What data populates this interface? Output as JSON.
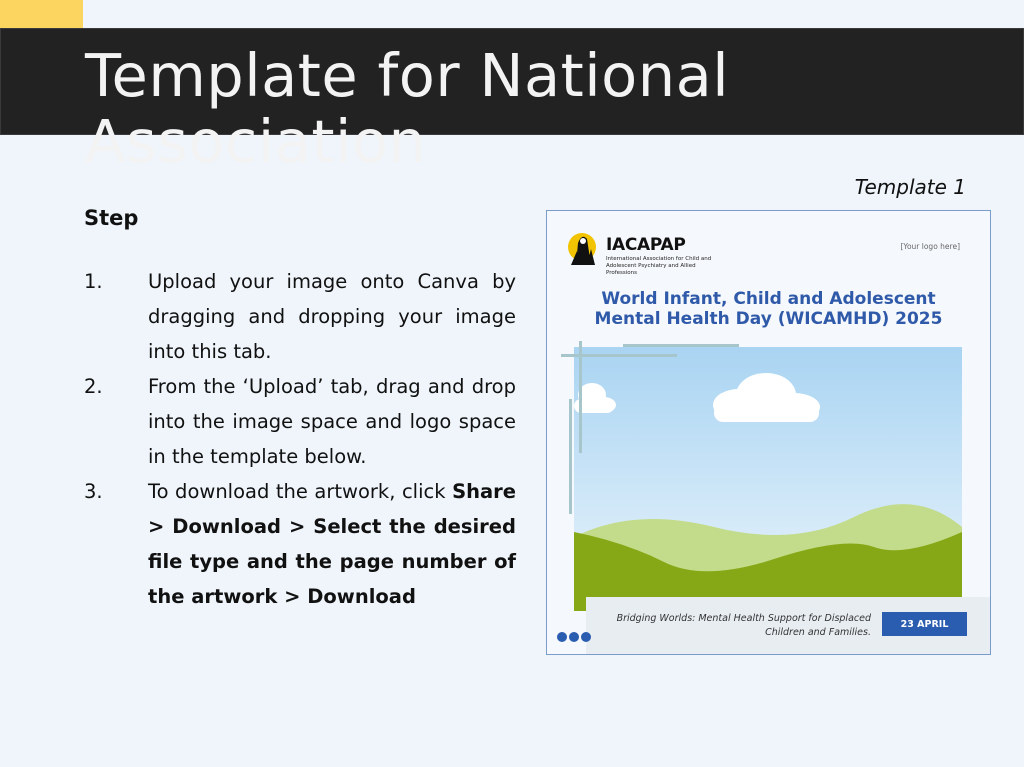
{
  "header": {
    "title_line1": "Template for National",
    "title_line2": "Association"
  },
  "instructions": {
    "heading": "Step",
    "steps": [
      {
        "num": "1.",
        "text": "Upload your image onto Canva by dragging and dropping your image into this tab."
      },
      {
        "num": "2.",
        "text": "From the ‘Upload’ tab, drag and drop into the image space and logo space in the template below."
      },
      {
        "num": "3.",
        "text_prefix": "To download the artwork, click ",
        "text_bold": "Share > Download > Select the desired file type and the page number of the artwork > Download"
      }
    ]
  },
  "template": {
    "label": "Template 1",
    "org_name": "IACAPAP",
    "org_subtitle": "International Association for Child and Adolescent Psychiatry and Allied Professions",
    "logo_placeholder": "[Your logo here]",
    "title_line1": "World Infant, Child and Adolescent",
    "title_line2": "Mental Health Day (WICAMHD) 2025",
    "footer_line1": "Bridging Worlds: Mental Health Support for Displaced",
    "footer_line2": "Children and Families.",
    "date": "23 APRIL"
  },
  "colors": {
    "accent": "#fbd560",
    "title_bar": "#222222",
    "brand_blue": "#2a5db0",
    "grass": "#86a816"
  }
}
